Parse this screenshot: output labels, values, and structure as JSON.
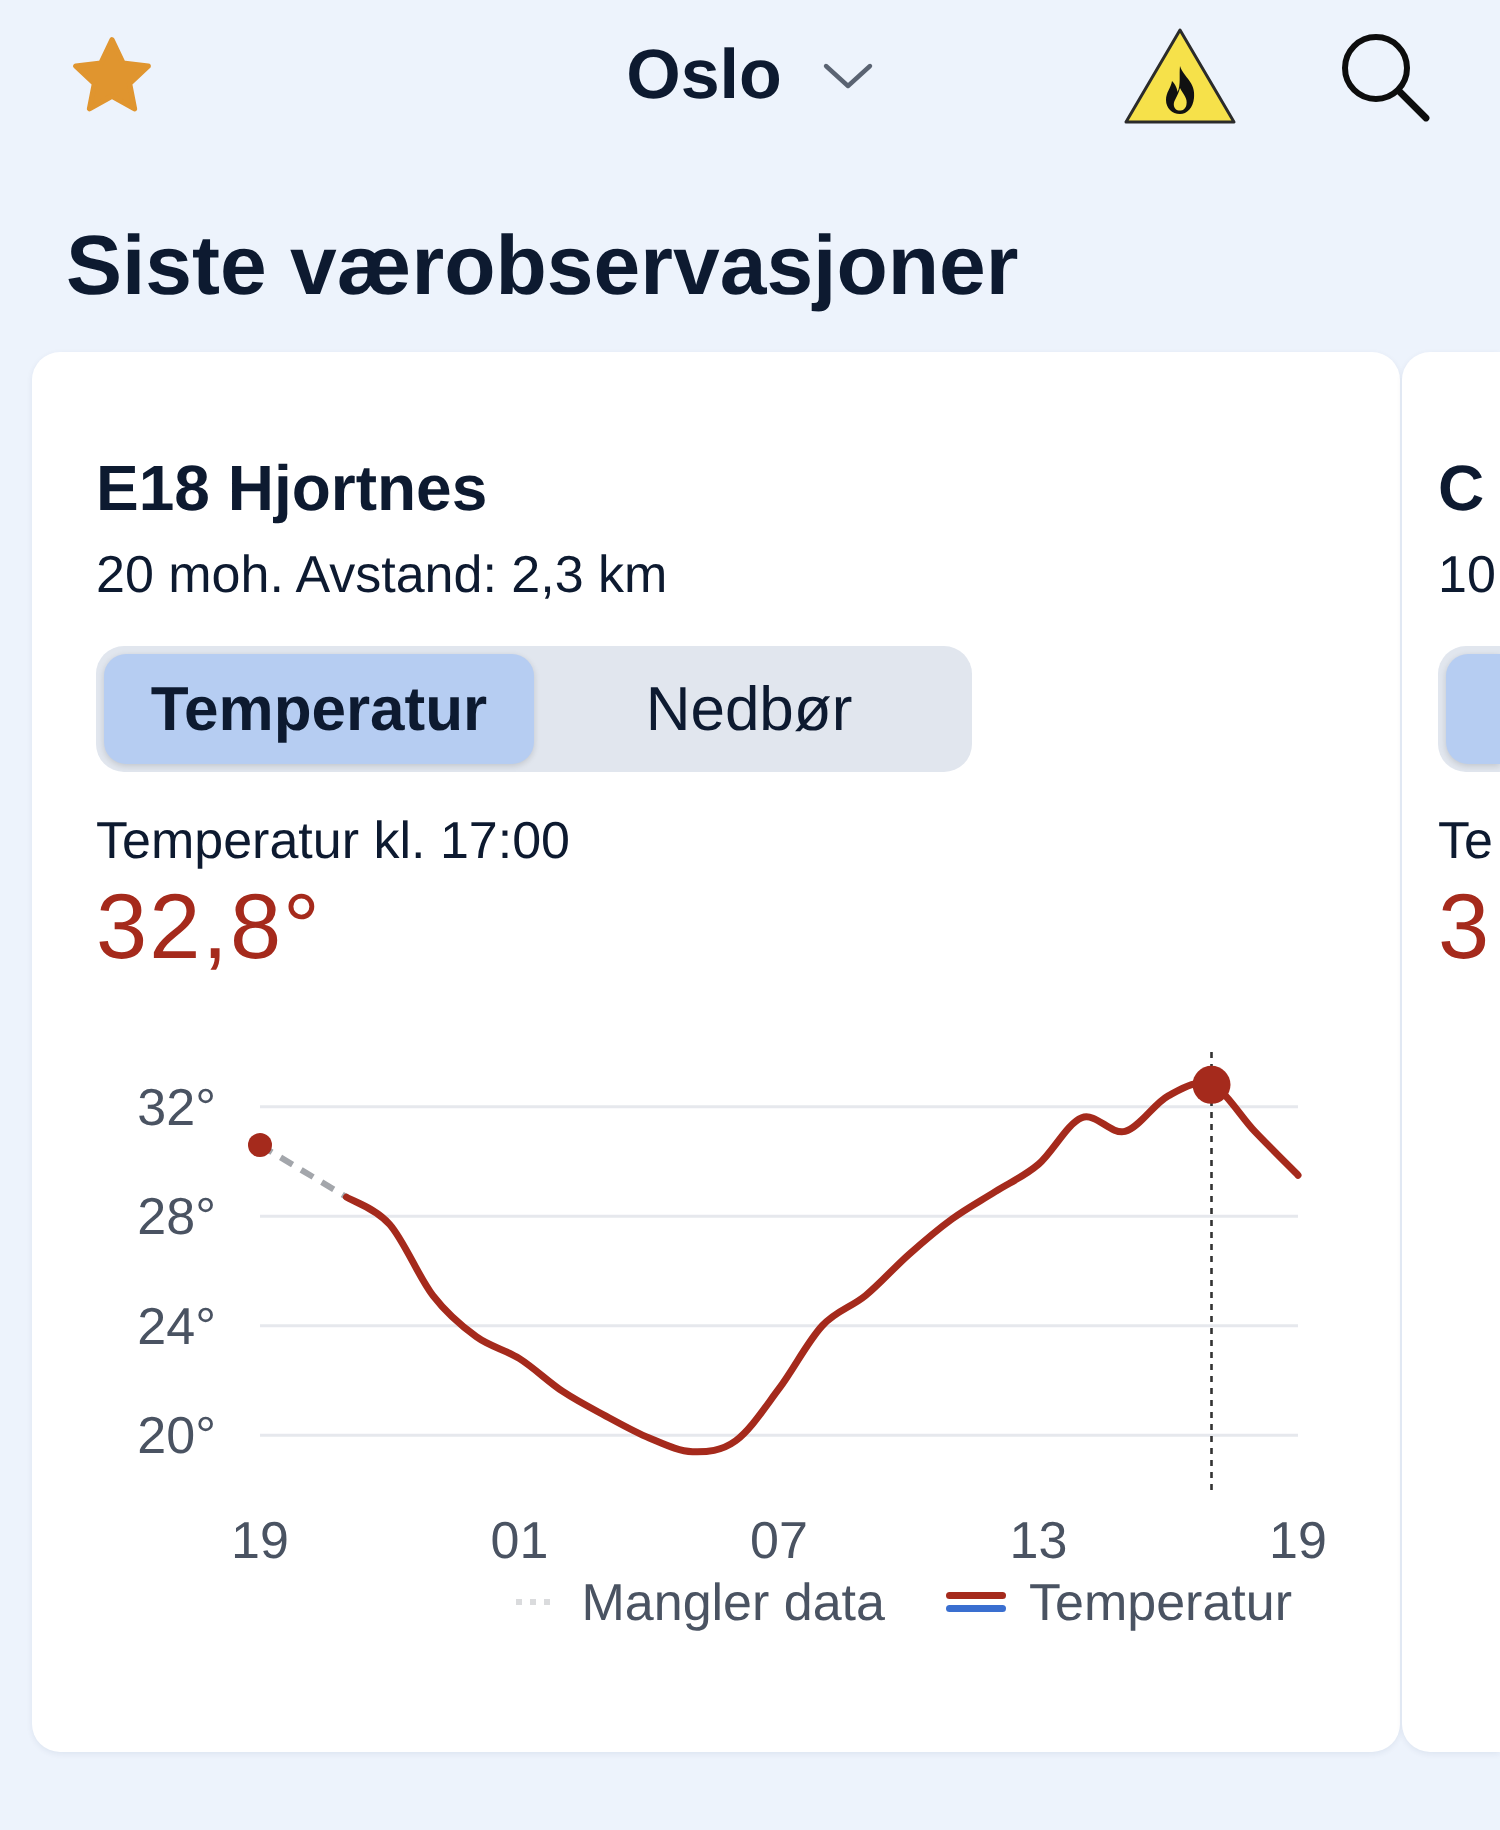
{
  "header": {
    "favorite": true,
    "location": "Oslo"
  },
  "title": "Siste værobservasjoner",
  "stations": [
    {
      "name": "E18 Hjortnes",
      "details": "20 moh. Avstand: 2,3 km",
      "tabs": [
        {
          "label": "Temperatur",
          "selected": true
        },
        {
          "label": "Nedbør",
          "selected": false
        }
      ],
      "reading_label": "Temperatur kl. 17:00",
      "reading_value": "32,8°",
      "chart_data": {
        "type": "line",
        "grid": true,
        "categories": [
          "19",
          null,
          null,
          null,
          null,
          null,
          "01",
          null,
          null,
          null,
          null,
          null,
          "07",
          null,
          null,
          null,
          null,
          null,
          "13",
          null,
          null,
          null,
          null,
          null,
          "19"
        ],
        "ylim": [
          18,
          34
        ],
        "yticks": [
          {
            "value": 20,
            "label": "20°"
          },
          {
            "value": 24,
            "label": "24°"
          },
          {
            "value": 28,
            "label": "28°"
          },
          {
            "value": 32,
            "label": "32°"
          }
        ],
        "series": [
          {
            "name": "Mangler data",
            "line_style": "dashed",
            "color": "#a3a6ab",
            "values": [
              30.6,
              29.65,
              28.7,
              null,
              null,
              null,
              null,
              null,
              null,
              null,
              null,
              null,
              null,
              null,
              null,
              null,
              null,
              null,
              null,
              null,
              null,
              null,
              null,
              null,
              null
            ]
          },
          {
            "name": "Temperatur",
            "line_style": "solid",
            "color": "#a52a1c",
            "values": [
              30.6,
              null,
              28.7,
              27.7,
              25.1,
              23.6,
              22.8,
              21.6,
              20.7,
              19.9,
              19.4,
              19.8,
              21.7,
              24.0,
              25.1,
              26.6,
              27.9,
              28.9,
              29.9,
              31.6,
              31.1,
              32.4,
              32.8,
              31.1,
              29.5
            ]
          },
          {
            "line_style": "none",
            "marker": "circle",
            "color": "#a52a1c",
            "values": [
              null,
              null,
              null,
              null,
              null,
              null,
              null,
              null,
              null,
              null,
              null,
              null,
              null,
              null,
              null,
              null,
              null,
              null,
              null,
              null,
              null,
              null,
              32.8,
              null,
              null
            ]
          }
        ]
      }
    },
    {
      "name": "C",
      "details": "10",
      "tabs": [
        {
          "selected": true
        }
      ],
      "reading_label": "Te",
      "reading_value": "3"
    }
  ]
}
